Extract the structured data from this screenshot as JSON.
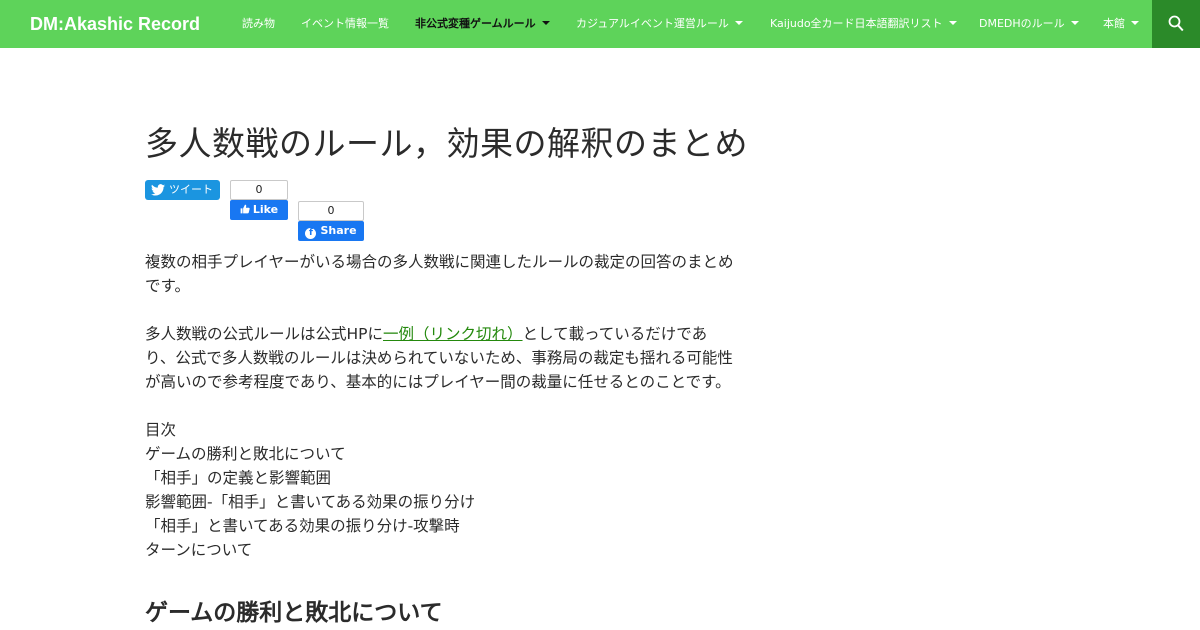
{
  "header": {
    "site_title": "DM:Akashic Record",
    "nav": [
      {
        "label": "読み物",
        "has_dropdown": false,
        "active": false
      },
      {
        "label": "イベント情報一覧",
        "has_dropdown": false,
        "active": false
      },
      {
        "label": "非公式変種ゲームルール",
        "has_dropdown": true,
        "active": true
      },
      {
        "label": "カジュアルイベント運営ルール",
        "has_dropdown": true,
        "active": false
      },
      {
        "label": "Kaijudo全カード日本語翻訳リスト",
        "has_dropdown": true,
        "active": false
      },
      {
        "label": "DMEDHのルール",
        "has_dropdown": true,
        "active": false
      },
      {
        "label": "本館",
        "has_dropdown": true,
        "active": false
      }
    ],
    "search_icon": "search-icon"
  },
  "article": {
    "title": "多人数戦のルール，効果の解釈のまとめ",
    "share": {
      "tweet_label": "ツイート",
      "like_count": "0",
      "like_label": "Like",
      "share_count": "0",
      "share_label": "Share"
    },
    "intro_line1": "複数の相手プレイヤーがいる場合の多人数戦に関連したルールの裁定の回答のまとめ",
    "intro_line2": "です。",
    "p2_before_link": "多人数戦の公式ルールは公式HPに",
    "p2_link": "一例（リンク切れ）",
    "p2_after_link": "として載っているだけであ",
    "p2_line2": "り、公式で多人数戦のルールは決められていないため、事務局の裁定も揺れる可能性",
    "p2_line3": "が高いので参考程度であり、基本的にはプレイヤー間の裁量に任せるとのことです。",
    "toc_heading": "目次",
    "toc": [
      "ゲームの勝利と敗北について",
      "「相手」の定義と影響範囲",
      "影響範囲-「相手」と書いてある効果の振り分け",
      "「相手」と書いてある効果の振り分け-攻撃時",
      "ターンについて"
    ],
    "section_heading": "ゲームの勝利と敗北について"
  },
  "colors": {
    "header_bg": "#5ed35a",
    "search_bg": "#2b8a29",
    "link": "#24890d",
    "tweet": "#1b95e0",
    "facebook": "#1877f2"
  }
}
